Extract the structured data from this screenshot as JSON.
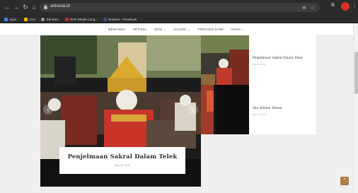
{
  "browser": {
    "url": "artnesia.id",
    "bookmarks": [
      {
        "label": "Apps",
        "color": "#4285f4"
      },
      {
        "label": "Acer",
        "color": "#f4b400"
      },
      {
        "label": "Tab Baru",
        "color": "#9e9e9e"
      },
      {
        "label": "RAR Bhakti Cang...",
        "color": "#d93025"
      },
      {
        "label": "Browser - Facebook",
        "color": "#3b5998"
      }
    ]
  },
  "nav": {
    "items": [
      "BERANDA",
      "ARTIKEL",
      "SENI ⌄",
      "GALERI ⌄",
      "TENTANG KAMI",
      "AKUN ⌄"
    ]
  },
  "slider": {
    "title": "Penjelmaan Sakral Dalam Telek",
    "date": "May 18, 2020",
    "prev": "‹",
    "next": "›"
  },
  "posts": [
    {
      "title": "Penjelmaan Sakral Dalam Telek",
      "date": "May 18, 2020"
    },
    {
      "title": "Aku Adalah Tetsee",
      "date": "May 17, 2020"
    }
  ],
  "scroll_top": "⌃",
  "colors": {
    "accent": "#b07a45",
    "chrome": "#2b2b2b"
  }
}
